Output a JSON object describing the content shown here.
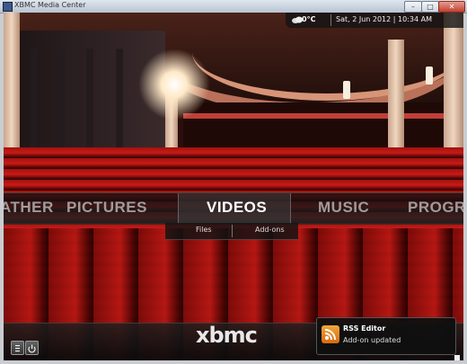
{
  "window": {
    "title": "XBMC Media Center",
    "minimize": "–",
    "maximize": "□",
    "close": "✕"
  },
  "header": {
    "temperature": "0°C",
    "datetime": "Sat, 2 Jun 2012 | 10:34 AM",
    "weather_icon": "weather-cloud-icon"
  },
  "main_menu": {
    "items": [
      "ATHER",
      "PICTURES",
      "VIDEOS",
      "MUSIC",
      "PROGRA"
    ],
    "selected": "VIDEOS"
  },
  "sub_menu": {
    "items": [
      "Files",
      "Add-ons"
    ]
  },
  "footer": {
    "logo": "xbmc",
    "notification": {
      "title": "RSS Editor",
      "message": "Add-on updated",
      "icon": "rss-icon"
    },
    "buttons": [
      "menu-icon",
      "power-icon"
    ]
  },
  "colors": {
    "accent": "#ffffff",
    "seat_red": "#c91a17",
    "toast_icon": "#e8892a"
  }
}
